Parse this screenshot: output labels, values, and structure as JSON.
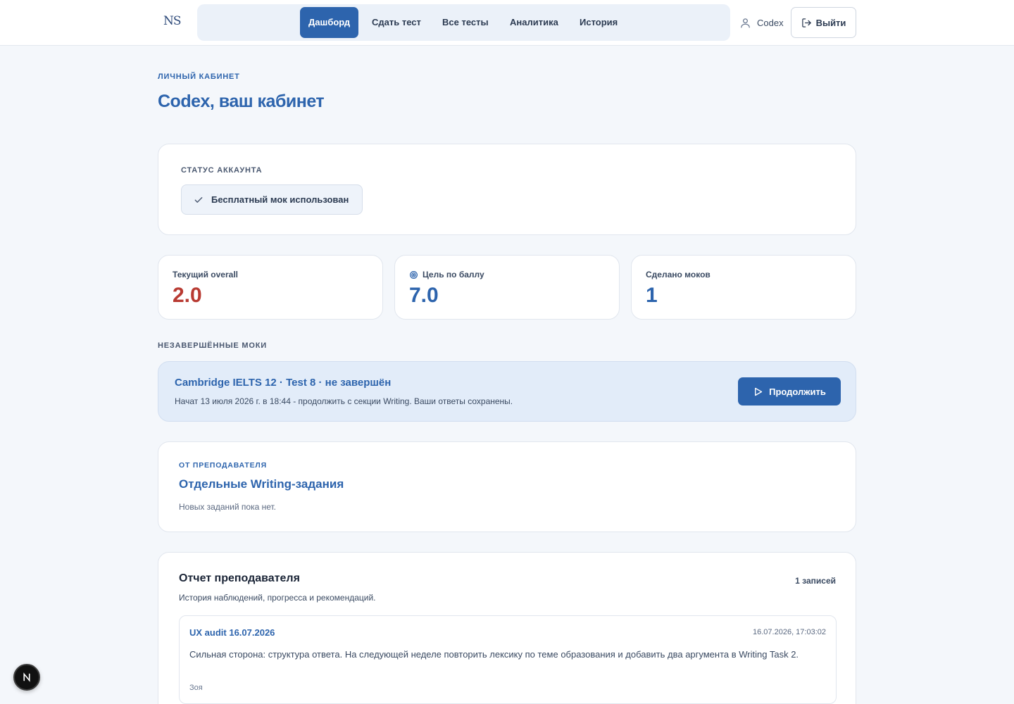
{
  "header": {
    "logo_text": "NS",
    "nav": [
      {
        "label": "Дашборд",
        "active": true
      },
      {
        "label": "Сдать тест",
        "active": false
      },
      {
        "label": "Все тесты",
        "active": false
      },
      {
        "label": "Аналитика",
        "active": false
      },
      {
        "label": "История",
        "active": false
      }
    ],
    "username": "Codex",
    "logout_label": "Выйти"
  },
  "page": {
    "eyebrow": "ЛИЧНЫЙ КАБИНЕТ",
    "title": "Codex, ваш кабинет"
  },
  "account_status": {
    "eyebrow": "СТАТУС АККАУНТА",
    "badge": "Бесплатный мок использован"
  },
  "stats": [
    {
      "label": "Текущий overall",
      "value": "2.0",
      "color": "#b83a32"
    },
    {
      "label": "Цель по баллу",
      "value": "7.0",
      "color": "#2d64ad",
      "icon": "target-icon"
    },
    {
      "label": "Сделано моков",
      "value": "1",
      "color": "#2d64ad"
    }
  ],
  "incomplete": {
    "eyebrow": "НЕЗАВЕРШЁННЫЕ МОКИ",
    "title": "Cambridge IELTS 12 · Test 8 · не завершён",
    "subtitle": "Начат 13 июля 2026 г. в 18:44 - продолжить с секции Writing. Ваши ответы сохранены.",
    "button": "Продолжить"
  },
  "teacher_tasks": {
    "eyebrow": "ОТ ПРЕПОДАВАТЕЛЯ",
    "title": "Отдельные Writing-задания",
    "empty": "Новых заданий пока нет."
  },
  "teacher_report": {
    "title": "Отчет преподавателя",
    "count": "1 записей",
    "subtitle": "История наблюдений, прогресса и рекомендаций.",
    "entries": [
      {
        "title": "UX audit 16.07.2026",
        "date": "16.07.2026, 17:03:02",
        "body": "Сильная сторона: структура ответа. На следующей неделе повторить лексику по теме образования и добавить два аргумента в Writing Task 2.",
        "author": "Зоя"
      }
    ]
  },
  "colors": {
    "accent": "#2d64ad",
    "danger": "#b83a32",
    "background": "#f4f7fb"
  }
}
